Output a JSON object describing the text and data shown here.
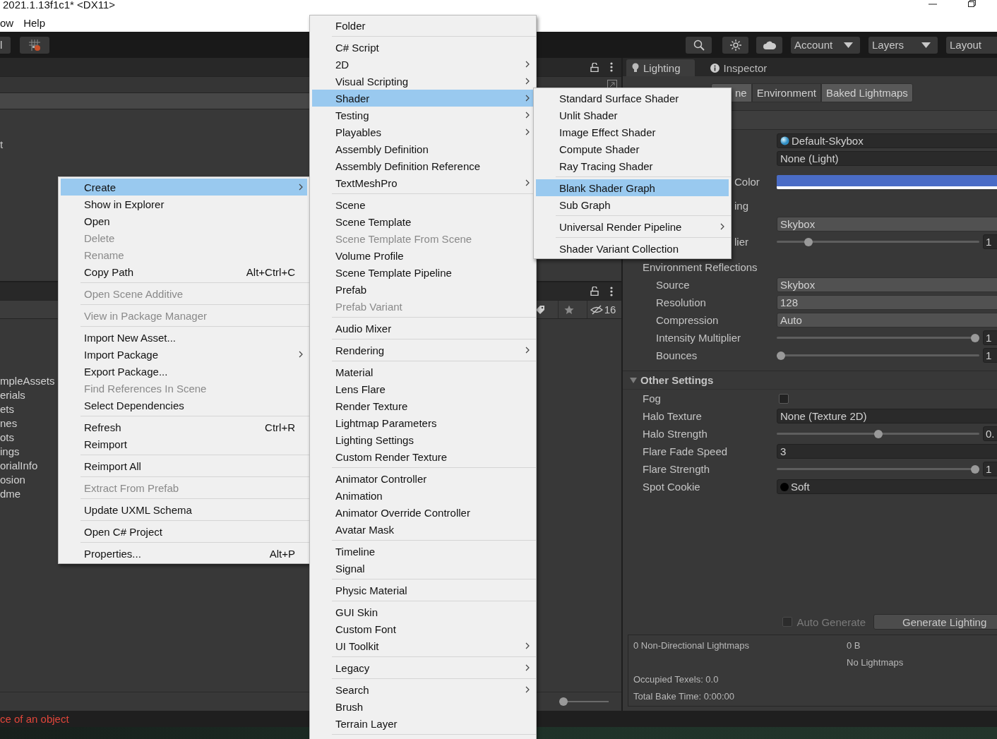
{
  "window": {
    "title": "2021.1.13f1c1* <DX11>"
  },
  "menubar": [
    {
      "label": "ow"
    },
    {
      "label": "Help"
    }
  ],
  "toolbar": {
    "cut_button": "l",
    "dropdowns": [
      {
        "label": "Account",
        "caret": true
      },
      {
        "label": "Layers",
        "caret": true
      },
      {
        "label": "Layout",
        "caret": false
      }
    ]
  },
  "hierarchy": {
    "cut_text": "t"
  },
  "project": {
    "items": [
      "mpleAssets",
      "erials",
      "ets",
      "nes",
      "ots",
      "ings",
      "orialInfo",
      "osion",
      "dme"
    ],
    "hidden_count": "16",
    "zoom_slider": {
      "level": 0
    }
  },
  "status_bar": {
    "message": "ce of an object"
  },
  "lighting": {
    "tabs": [
      {
        "label": "Lighting",
        "selected": true
      },
      {
        "label": "Inspector",
        "selected": false
      }
    ],
    "subtabs": [
      {
        "label": "ne",
        "selected": false
      },
      {
        "label": "Environment",
        "selected": true
      },
      {
        "label": "Baked Lightmaps",
        "selected": false
      }
    ],
    "rows": [
      {
        "kind": "skybox",
        "value": "Default-Skybox"
      },
      {
        "kind": "object",
        "value": "None (Light)"
      },
      {
        "kind": "color",
        "label": "Color",
        "partial": true,
        "color": "#4a6cc6"
      },
      {
        "kind": "label",
        "label": "ing",
        "partial": true
      },
      {
        "kind": "dropdown",
        "value": "Skybox"
      },
      {
        "kind": "slider",
        "label": "lier",
        "partial": true,
        "level": 0.14,
        "reading": "1"
      },
      {
        "kind": "group",
        "label": "Environment Reflections",
        "children": [
          {
            "kind": "dropdown",
            "label": "Source",
            "value": "Skybox"
          },
          {
            "kind": "dropdown",
            "label": "Resolution",
            "value": "128"
          },
          {
            "kind": "dropdown",
            "label": "Compression",
            "value": "Auto"
          },
          {
            "kind": "slider",
            "label": "Intensity Multiplier",
            "level": 1,
            "reading": "1"
          },
          {
            "kind": "slider",
            "label": "Bounces",
            "level": 0,
            "reading": "1"
          }
        ]
      },
      {
        "kind": "foldout",
        "label": "Other Settings",
        "expanded": true,
        "children": [
          {
            "kind": "checkbox",
            "label": "Fog",
            "checked": false
          },
          {
            "kind": "object",
            "label": "Halo Texture",
            "value": "None (Texture 2D)"
          },
          {
            "kind": "slider",
            "label": "Halo Strength",
            "level": 0.5,
            "reading": "0."
          },
          {
            "kind": "number",
            "label": "Flare Fade Speed",
            "value": "3"
          },
          {
            "kind": "slider",
            "label": "Flare Strength",
            "level": 1,
            "reading": "1"
          },
          {
            "kind": "cookie",
            "label": "Spot Cookie",
            "value": "Soft"
          }
        ]
      }
    ],
    "auto_generate": {
      "label": "Auto Generate",
      "checked": false,
      "disabled": true
    },
    "generate_button": "Generate Lighting",
    "stats": [
      {
        "left": "0 Non-Directional Lightmaps",
        "right": "0 B"
      },
      {
        "right": "No Lightmaps"
      },
      {
        "left": "Occupied Texels: 0.0"
      },
      {
        "left": "Total Bake Time: 0:00:00"
      }
    ]
  },
  "context_menu": {
    "groups": [
      [
        {
          "label": "Create",
          "submenu": true,
          "disabled": false,
          "selected": true
        },
        {
          "label": "Show in Explorer",
          "submenu": false,
          "disabled": false,
          "selected": false
        },
        {
          "label": "Open",
          "submenu": false,
          "disabled": false,
          "selected": false
        },
        {
          "label": "Delete",
          "submenu": false,
          "disabled": true,
          "selected": false
        },
        {
          "label": "Rename",
          "submenu": false,
          "disabled": true,
          "selected": false
        },
        {
          "label": "Copy Path",
          "shortcut": "Alt+Ctrl+C",
          "submenu": false,
          "disabled": false,
          "selected": false
        }
      ],
      [
        {
          "label": "Open Scene Additive",
          "submenu": false,
          "disabled": true,
          "selected": false
        }
      ],
      [
        {
          "label": "View in Package Manager",
          "submenu": false,
          "disabled": true,
          "selected": false
        }
      ],
      [
        {
          "label": "Import New Asset...",
          "submenu": false,
          "disabled": false,
          "selected": false
        },
        {
          "label": "Import Package",
          "submenu": true,
          "disabled": false,
          "selected": false
        },
        {
          "label": "Export Package...",
          "submenu": false,
          "disabled": false,
          "selected": false
        },
        {
          "label": "Find References In Scene",
          "submenu": false,
          "disabled": true,
          "selected": false
        },
        {
          "label": "Select Dependencies",
          "submenu": false,
          "disabled": false,
          "selected": false
        }
      ],
      [
        {
          "label": "Refresh",
          "shortcut": "Ctrl+R",
          "submenu": false,
          "disabled": false,
          "selected": false
        },
        {
          "label": "Reimport",
          "submenu": false,
          "disabled": false,
          "selected": false
        }
      ],
      [
        {
          "label": "Reimport All",
          "submenu": false,
          "disabled": false,
          "selected": false
        }
      ],
      [
        {
          "label": "Extract From Prefab",
          "submenu": false,
          "disabled": true,
          "selected": false
        }
      ],
      [
        {
          "label": "Update UXML Schema",
          "submenu": false,
          "disabled": false,
          "selected": false
        }
      ],
      [
        {
          "label": "Open C# Project",
          "submenu": false,
          "disabled": false,
          "selected": false
        }
      ],
      [
        {
          "label": "Properties...",
          "shortcut": "Alt+P",
          "submenu": false,
          "disabled": false,
          "selected": false
        }
      ]
    ]
  },
  "create_menu": {
    "continues": true,
    "groups": [
      [
        {
          "label": "Folder",
          "submenu": false,
          "disabled": false,
          "selected": false
        }
      ],
      [
        {
          "label": "C# Script",
          "submenu": false,
          "disabled": false,
          "selected": false
        },
        {
          "label": "2D",
          "submenu": true,
          "disabled": false,
          "selected": false
        },
        {
          "label": "Visual Scripting",
          "submenu": true,
          "disabled": false,
          "selected": false
        },
        {
          "label": "Shader",
          "submenu": true,
          "disabled": false,
          "selected": true
        },
        {
          "label": "Testing",
          "submenu": true,
          "disabled": false,
          "selected": false
        },
        {
          "label": "Playables",
          "submenu": true,
          "disabled": false,
          "selected": false
        },
        {
          "label": "Assembly Definition",
          "submenu": false,
          "disabled": false,
          "selected": false
        },
        {
          "label": "Assembly Definition Reference",
          "submenu": false,
          "disabled": false,
          "selected": false
        },
        {
          "label": "TextMeshPro",
          "submenu": true,
          "disabled": false,
          "selected": false
        }
      ],
      [
        {
          "label": "Scene",
          "submenu": false,
          "disabled": false,
          "selected": false
        },
        {
          "label": "Scene Template",
          "submenu": false,
          "disabled": false,
          "selected": false
        },
        {
          "label": "Scene Template From Scene",
          "submenu": false,
          "disabled": true,
          "selected": false
        },
        {
          "label": "Volume Profile",
          "submenu": false,
          "disabled": false,
          "selected": false
        },
        {
          "label": "Scene Template Pipeline",
          "submenu": false,
          "disabled": false,
          "selected": false
        },
        {
          "label": "Prefab",
          "submenu": false,
          "disabled": false,
          "selected": false
        },
        {
          "label": "Prefab Variant",
          "submenu": false,
          "disabled": true,
          "selected": false
        }
      ],
      [
        {
          "label": "Audio Mixer",
          "submenu": false,
          "disabled": false,
          "selected": false
        }
      ],
      [
        {
          "label": "Rendering",
          "submenu": true,
          "disabled": false,
          "selected": false
        }
      ],
      [
        {
          "label": "Material",
          "submenu": false,
          "disabled": false,
          "selected": false
        },
        {
          "label": "Lens Flare",
          "submenu": false,
          "disabled": false,
          "selected": false
        },
        {
          "label": "Render Texture",
          "submenu": false,
          "disabled": false,
          "selected": false
        },
        {
          "label": "Lightmap Parameters",
          "submenu": false,
          "disabled": false,
          "selected": false
        },
        {
          "label": "Lighting Settings",
          "submenu": false,
          "disabled": false,
          "selected": false
        },
        {
          "label": "Custom Render Texture",
          "submenu": false,
          "disabled": false,
          "selected": false
        }
      ],
      [
        {
          "label": "Animator Controller",
          "submenu": false,
          "disabled": false,
          "selected": false
        },
        {
          "label": "Animation",
          "submenu": false,
          "disabled": false,
          "selected": false
        },
        {
          "label": "Animator Override Controller",
          "submenu": false,
          "disabled": false,
          "selected": false
        },
        {
          "label": "Avatar Mask",
          "submenu": false,
          "disabled": false,
          "selected": false
        }
      ],
      [
        {
          "label": "Timeline",
          "submenu": false,
          "disabled": false,
          "selected": false
        },
        {
          "label": "Signal",
          "submenu": false,
          "disabled": false,
          "selected": false
        }
      ],
      [
        {
          "label": "Physic Material",
          "submenu": false,
          "disabled": false,
          "selected": false
        }
      ],
      [
        {
          "label": "GUI Skin",
          "submenu": false,
          "disabled": false,
          "selected": false
        },
        {
          "label": "Custom Font",
          "submenu": false,
          "disabled": false,
          "selected": false
        },
        {
          "label": "UI Toolkit",
          "submenu": true,
          "disabled": false,
          "selected": false
        }
      ],
      [
        {
          "label": "Legacy",
          "submenu": true,
          "disabled": false,
          "selected": false
        }
      ],
      [
        {
          "label": "Search",
          "submenu": true,
          "disabled": false,
          "selected": false
        },
        {
          "label": "Brush",
          "submenu": false,
          "disabled": false,
          "selected": false
        },
        {
          "label": "Terrain Layer",
          "submenu": false,
          "disabled": false,
          "selected": false
        }
      ]
    ]
  },
  "shader_menu": {
    "groups": [
      [
        {
          "label": "Standard Surface Shader",
          "submenu": false,
          "disabled": false,
          "selected": false
        },
        {
          "label": "Unlit Shader",
          "submenu": false,
          "disabled": false,
          "selected": false
        },
        {
          "label": "Image Effect Shader",
          "submenu": false,
          "disabled": false,
          "selected": false
        },
        {
          "label": "Compute Shader",
          "submenu": false,
          "disabled": false,
          "selected": false
        },
        {
          "label": "Ray Tracing Shader",
          "submenu": false,
          "disabled": false,
          "selected": false
        }
      ],
      [
        {
          "label": "Blank Shader Graph",
          "submenu": false,
          "disabled": false,
          "selected": true
        },
        {
          "label": "Sub Graph",
          "submenu": false,
          "disabled": false,
          "selected": false
        }
      ],
      [
        {
          "label": "Universal Render Pipeline",
          "submenu": true,
          "disabled": false,
          "selected": false
        }
      ],
      [
        {
          "label": "Shader Variant Collection",
          "submenu": false,
          "disabled": false,
          "selected": false
        }
      ]
    ]
  }
}
